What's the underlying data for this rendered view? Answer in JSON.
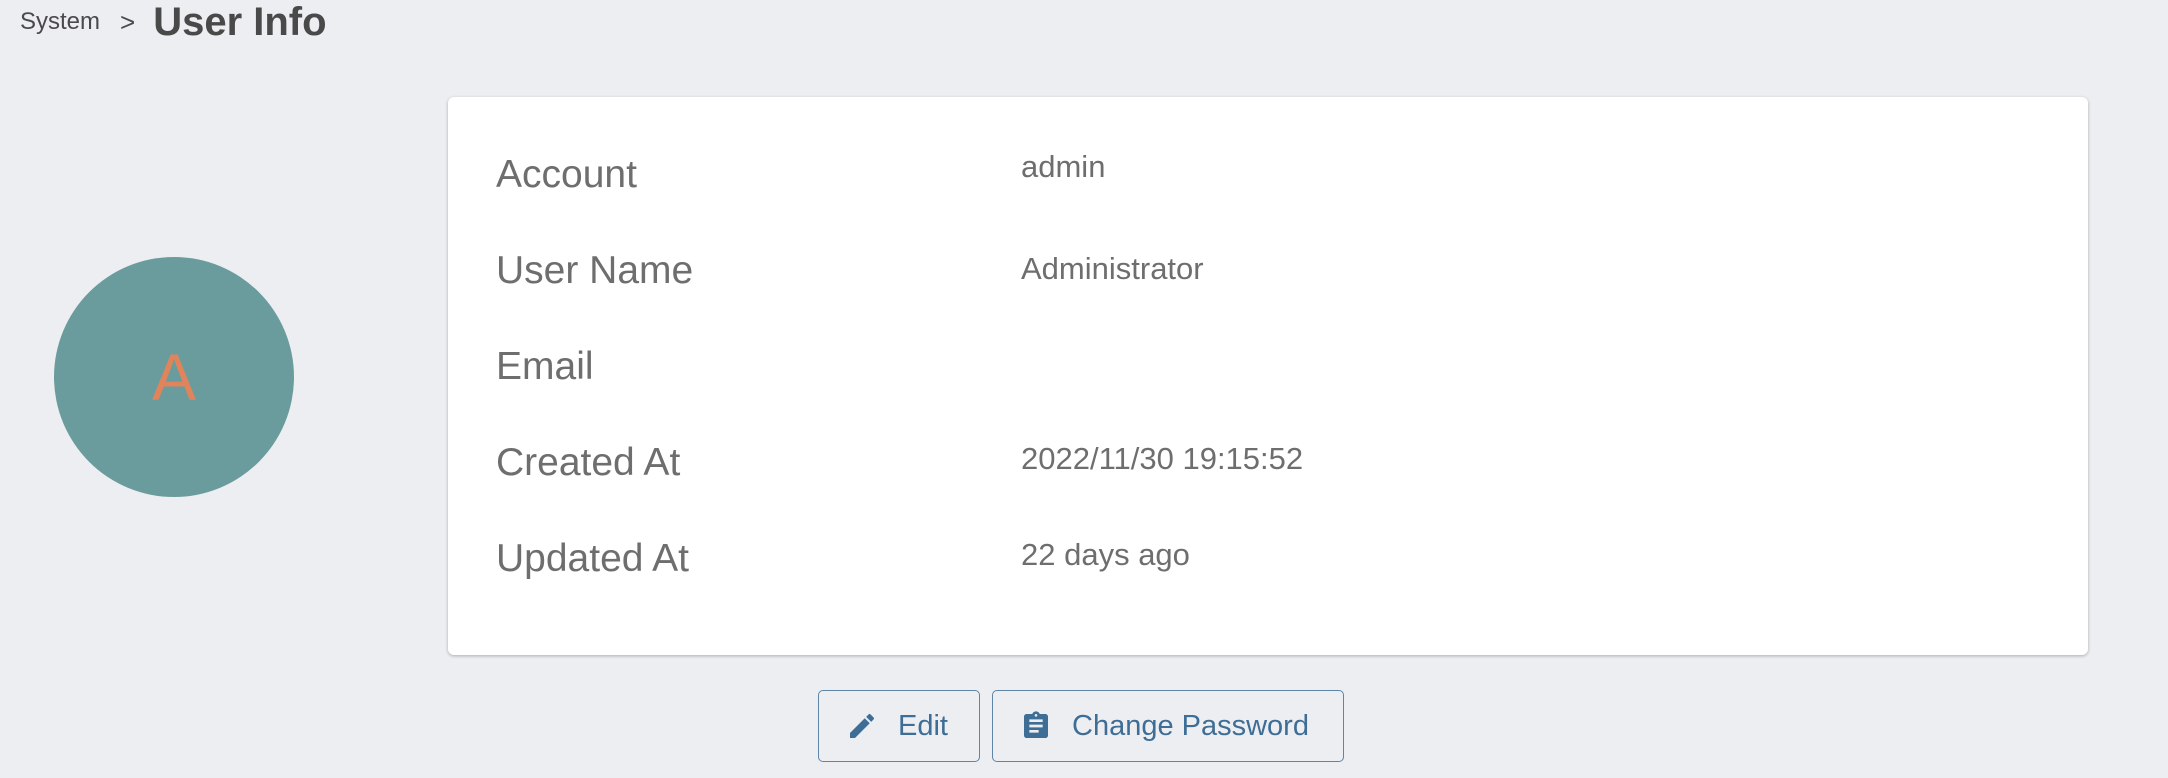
{
  "breadcrumb": {
    "parent": "System",
    "separator": ">",
    "title": "User Info"
  },
  "avatar": {
    "letter": "A",
    "background_color": "#6b9c9d",
    "letter_color": "#e0845c"
  },
  "user_info": {
    "rows": [
      {
        "label": "Account",
        "value": "admin"
      },
      {
        "label": "User Name",
        "value": "Administrator"
      },
      {
        "label": "Email",
        "value": ""
      },
      {
        "label": "Created At",
        "value": "2022/11/30 19:15:52"
      },
      {
        "label": "Updated At",
        "value": "22 days ago"
      }
    ]
  },
  "actions": {
    "edit_label": "Edit",
    "edit_icon": "pencil-icon",
    "change_password_label": "Change Password",
    "change_password_icon": "clipboard-icon"
  },
  "colors": {
    "accent": "#3e6d96",
    "background": "#edeef2"
  }
}
